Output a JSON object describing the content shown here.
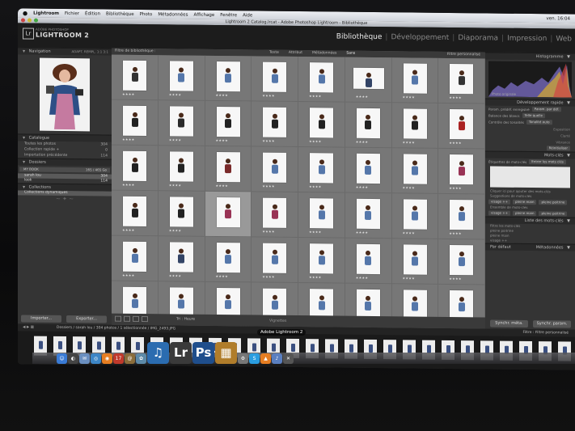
{
  "menubar": {
    "apple": "",
    "items": [
      "Lightroom",
      "Fichier",
      "Édition",
      "Bibliothèque",
      "Photo",
      "Métadonnées",
      "Affichage",
      "Fenêtre",
      "Aide"
    ],
    "clock": "ven. 16:04"
  },
  "window": {
    "title": "Lightroom 2 Catalog.lrcat - Adobe Photoshop Lightroom - Bibliothèque"
  },
  "identity": {
    "logo_mark": "Lr",
    "brand_small": "ADOBE PHOTOSHOP",
    "brand_name": "LIGHTROOM 2"
  },
  "modules": {
    "items": [
      "Bibliothèque",
      "Développement",
      "Diaporama",
      "Impression",
      "Web"
    ],
    "active": "Bibliothèque",
    "separator": "|"
  },
  "left_panel": {
    "navigation": {
      "title": "Navigation",
      "zoom": "ADAPT. REMPL. 1:1 3:1"
    },
    "catalogue": {
      "title": "Catalogue",
      "rows": [
        {
          "label": "Toutes les photos",
          "count": "304"
        },
        {
          "label": "Collection rapide +",
          "count": "0"
        },
        {
          "label": "Importation précédente",
          "count": "114"
        }
      ]
    },
    "dossiers": {
      "title": "Dossiers",
      "volume": "MY BOOK",
      "volume_size": "165 / 465 Go",
      "items": [
        {
          "label": "sarah lou",
          "count": "304"
        },
        {
          "label": "look",
          "count": "114"
        }
      ]
    },
    "collections": {
      "title": "Collections",
      "items": [
        {
          "label": "Collections dynamiques"
        }
      ]
    },
    "ornament": "~ ✦ ~",
    "buttons": {
      "import": "Importer...",
      "export": "Exporter..."
    }
  },
  "filter_bar": {
    "title": "Filtre de bibliothèque :",
    "options": [
      "Texte",
      "Attribut",
      "Métadonnées",
      "Sans"
    ],
    "active": "Sans",
    "preset": "Filtre personnalisé"
  },
  "grid": {
    "cells": [
      {
        "star": "★★★★",
        "c": "#333",
        "land": false,
        "sel": false
      },
      {
        "star": "★★★★",
        "c": "#5577aa",
        "land": false,
        "sel": false
      },
      {
        "star": "★★★★",
        "c": "#5577aa",
        "land": false,
        "sel": false
      },
      {
        "star": "★★★★",
        "c": "#5577aa",
        "land": false,
        "sel": false
      },
      {
        "star": "★★★★",
        "c": "#5577aa",
        "land": false,
        "sel": false
      },
      {
        "star": "★★★★",
        "c": "#334466",
        "land": true,
        "sel": false
      },
      {
        "star": "★★★★",
        "c": "#5577aa",
        "land": false,
        "sel": false
      },
      {
        "star": "★★★★",
        "c": "#333",
        "land": false,
        "sel": false
      },
      {
        "star": "★★★★",
        "c": "#222",
        "land": false,
        "sel": false
      },
      {
        "star": "★★★★",
        "c": "#2a2a2a",
        "land": false,
        "sel": false
      },
      {
        "star": "★★★★",
        "c": "#222",
        "land": false,
        "sel": false
      },
      {
        "star": "★★★★",
        "c": "#222",
        "land": false,
        "sel": false
      },
      {
        "star": "★★★★",
        "c": "#222",
        "land": false,
        "sel": false
      },
      {
        "star": "★★★★",
        "c": "#222",
        "land": false,
        "sel": false
      },
      {
        "star": "★★★★",
        "c": "#222",
        "land": false,
        "sel": false
      },
      {
        "star": "★★★★",
        "c": "#aa2222",
        "land": false,
        "sel": false
      },
      {
        "star": "★★★★",
        "c": "#222",
        "land": false,
        "sel": false
      },
      {
        "star": "★★★★",
        "c": "#222",
        "land": false,
        "sel": false
      },
      {
        "star": "★★★★",
        "c": "#7a2a2a",
        "land": false,
        "sel": false
      },
      {
        "star": "★★★★",
        "c": "#5577aa",
        "land": false,
        "sel": false
      },
      {
        "star": "★★★★",
        "c": "#5577aa",
        "land": false,
        "sel": false
      },
      {
        "star": "★★★★",
        "c": "#5577aa",
        "land": false,
        "sel": false
      },
      {
        "star": "★★★★",
        "c": "#5577aa",
        "land": false,
        "sel": false
      },
      {
        "star": "★★★★",
        "c": "#993355",
        "land": false,
        "sel": false
      },
      {
        "star": "★★★★",
        "c": "#222",
        "land": false,
        "sel": false
      },
      {
        "star": "★★★★",
        "c": "#222",
        "land": false,
        "sel": false
      },
      {
        "star": "",
        "c": "#993355",
        "land": false,
        "sel": true
      },
      {
        "star": "★★★★",
        "c": "#993355",
        "land": false,
        "sel": false
      },
      {
        "star": "★★★★",
        "c": "#5577aa",
        "land": false,
        "sel": false
      },
      {
        "star": "★★★★",
        "c": "#5577aa",
        "land": false,
        "sel": false
      },
      {
        "star": "★★★★",
        "c": "#5577aa",
        "land": false,
        "sel": false
      },
      {
        "star": "★★★★",
        "c": "#5577aa",
        "land": false,
        "sel": false
      },
      {
        "star": "★★★★",
        "c": "#5577aa",
        "land": false,
        "sel": false
      },
      {
        "star": "★★★★",
        "c": "#334466",
        "land": false,
        "sel": false
      },
      {
        "star": "★★★★",
        "c": "#5577aa",
        "land": false,
        "sel": false
      },
      {
        "star": "★★★★",
        "c": "#5577aa",
        "land": false,
        "sel": false
      },
      {
        "star": "★★★★",
        "c": "#5577aa",
        "land": false,
        "sel": false
      },
      {
        "star": "★★★★",
        "c": "#5577aa",
        "land": false,
        "sel": false
      },
      {
        "star": "★★★★",
        "c": "#5577aa",
        "land": false,
        "sel": false
      },
      {
        "star": "★★★★",
        "c": "#5577aa",
        "land": false,
        "sel": false
      },
      {
        "star": "",
        "c": "#5577aa",
        "land": false,
        "sel": false
      },
      {
        "star": "",
        "c": "#5577aa",
        "land": false,
        "sel": false
      },
      {
        "star": "",
        "c": "#5577aa",
        "land": false,
        "sel": false
      },
      {
        "star": "",
        "c": "#5577aa",
        "land": false,
        "sel": false
      },
      {
        "star": "",
        "c": "#5577aa",
        "land": false,
        "sel": false
      },
      {
        "star": "",
        "c": "#5577aa",
        "land": false,
        "sel": false
      },
      {
        "star": "",
        "c": "#5577aa",
        "land": false,
        "sel": false
      },
      {
        "star": "",
        "c": "#5577aa",
        "land": false,
        "sel": false
      }
    ]
  },
  "grid_toolbar": {
    "sort_label": "Tri : Heure",
    "thumbnails_label": "Vignettes"
  },
  "right_panel": {
    "histogram_title": "Histogramme",
    "original_photo": "Photo originale",
    "quick_develop": {
      "title": "Développement rapide",
      "rows": [
        {
          "label": "Param. prédéf. enregistré",
          "value": "Param. par déf."
        },
        {
          "label": "Balance des blancs",
          "value": "Telle quelle"
        },
        {
          "label": "Contrôle des tonalités",
          "value": "Tonalité auto"
        }
      ],
      "sub_rows": [
        "Exposition",
        "Clarté",
        "Vibrance"
      ],
      "reset": "Réinitialiser"
    },
    "keywords": {
      "title": "Mots-clés",
      "tag_label": "Étiquettes de mots-clés",
      "tag_value": "Entrer les mots clés",
      "hint": "Cliquer ici pour ajouter des mots-clés",
      "suggestions": "Suggestions de mots-clés",
      "suggestion_items": [
        "visage ++",
        "pleine main",
        "pleine poitrine"
      ],
      "set_label": "Ensemble de mots-clés",
      "set_items": [
        "visage ++",
        "pleine main",
        "pleine poitrine"
      ]
    },
    "keyword_list": {
      "title": "Liste des mots-clés",
      "filter": "Filtre les mots-clés",
      "items": [
        "pleine poitrine",
        "pleine main",
        "visage ++"
      ]
    },
    "metadata": {
      "title": "Métadonnées",
      "preset": "Par défaut"
    },
    "buttons": {
      "sync_meta": "Synchr. méta.",
      "sync_params": "Synchr. param."
    }
  },
  "filmstrip_bar": {
    "path": "Dossiers / sarah lou / 304 photos / 1 sélectionnée / IMG_2493.JPG",
    "filter_label": "Filtre :",
    "filter_value": "Filtre personnalisé"
  },
  "dock": {
    "tooltip": "Adobe Lightroom 2",
    "apps": [
      {
        "name": "finder",
        "glyph": "☺",
        "color": "#3a7bd5"
      },
      {
        "name": "dashboard",
        "glyph": "◐",
        "color": "#444"
      },
      {
        "name": "mail",
        "glyph": "✉",
        "color": "#6a8fc0"
      },
      {
        "name": "safari",
        "glyph": "◎",
        "color": "#3d86c6"
      },
      {
        "name": "firefox",
        "glyph": "◉",
        "color": "#e67e22"
      },
      {
        "name": "ical",
        "glyph": "17",
        "color": "#c0392b"
      },
      {
        "name": "addressbook",
        "glyph": "@",
        "color": "#8a6d3b"
      },
      {
        "name": "iphoto",
        "glyph": "✿",
        "color": "#5d8aa8"
      },
      {
        "name": "itunes",
        "glyph": "♫",
        "color": "#2b6cb0",
        "big": true
      },
      {
        "name": "lightroom",
        "glyph": "Lr",
        "color": "#3a3a3a",
        "big": true
      },
      {
        "name": "photoshop",
        "glyph": "Ps",
        "color": "#1f4e8c",
        "big": true
      },
      {
        "name": "preview",
        "glyph": "▦",
        "color": "#b07d2b",
        "big": true
      },
      {
        "name": "system-prefs",
        "glyph": "⚙",
        "color": "#777"
      },
      {
        "name": "skype",
        "glyph": "S",
        "color": "#2a9de0"
      },
      {
        "name": "vlc",
        "glyph": "▲",
        "color": "#e67e22"
      },
      {
        "name": "itunes-small",
        "glyph": "♪",
        "color": "#5a7fc0"
      },
      {
        "name": "utility",
        "glyph": "✕",
        "color": "#555"
      }
    ]
  }
}
